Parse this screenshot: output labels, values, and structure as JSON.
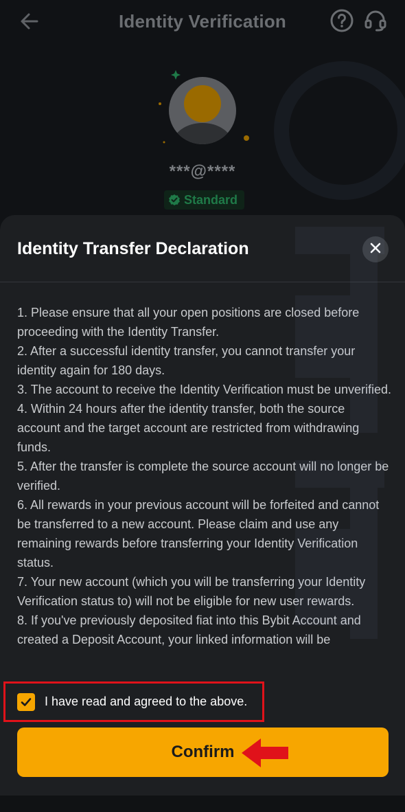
{
  "header": {
    "title": "Identity Verification"
  },
  "profile": {
    "username": "***@****",
    "badge": "Standard"
  },
  "sheet": {
    "title": "Identity Transfer Declaration",
    "terms": [
      "1. Please ensure that all your open positions are closed before proceeding with the Identity Transfer.",
      "2. After a successful identity transfer, you cannot transfer your identity again for 180 days.",
      "3. The account to receive the Identity Verification must be unverified.",
      "4. Within 24 hours after the identity transfer, both the source account and the target account are restricted from withdrawing funds.",
      "5. After the transfer is complete the source account will no longer be verified.",
      "6. All rewards in your previous account will be forfeited and cannot be transferred to a new account. Please claim and use any remaining rewards before transferring your Identity Verification status.",
      "7. Your new account (which you will be transferring your Identity Verification status to) will not be eligible for new user rewards.",
      "8. If you've previously deposited fiat into this Bybit Account and created a Deposit Account, your linked information will be"
    ],
    "agree_label": "I have read and agreed to the above.",
    "agree_checked": true,
    "confirm_label": "Confirm"
  },
  "colors": {
    "accent": "#f7a600",
    "highlight": "#e0121a",
    "badge": "#1f7a48"
  }
}
